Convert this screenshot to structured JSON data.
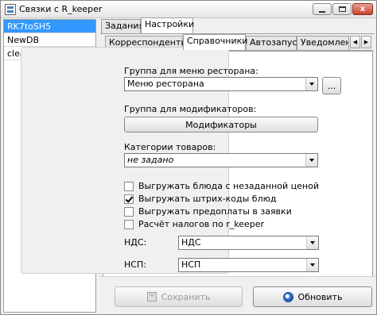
{
  "window": {
    "title": "Связки с R_keeper",
    "minimize_label": "",
    "maximize_label": "",
    "close_label": "x"
  },
  "list": {
    "items": [
      {
        "label": "RK7toSH5",
        "selected": true
      },
      {
        "label": "NewDB",
        "selected": false
      },
      {
        "label": "clear",
        "selected": false
      }
    ]
  },
  "outer_tabs": [
    {
      "label": "Задания",
      "active": false
    },
    {
      "label": "Настройки",
      "active": true
    }
  ],
  "inner_tabs": [
    {
      "label": "Корреспонденты",
      "active": false
    },
    {
      "label": "Справочники",
      "active": true
    },
    {
      "label": "Автозапуск",
      "active": false
    },
    {
      "label": "Уведомлени",
      "active": false
    }
  ],
  "form": {
    "menu_group_label": "Группа для меню ресторана:",
    "menu_group_value": "Меню ресторана",
    "browse_label": "...",
    "modifier_group_label": "Группа для модификаторов:",
    "modifier_button_label": "Модификаторы",
    "categories_label": "Категории товаров:",
    "categories_value": "не задано",
    "checkboxes": [
      {
        "label": "Выгружать блюда с незаданной ценой",
        "checked": false
      },
      {
        "label": "Выгружать штрих-коды блюд",
        "checked": true
      },
      {
        "label": "Выгружать предоплаты в заявки",
        "checked": false
      },
      {
        "label": "Расчёт налогов по r_keeper",
        "checked": false
      }
    ],
    "nds_label": "НДС:",
    "nds_value": "НДС",
    "nsp_label": "НСП:",
    "nsp_value": "НСП"
  },
  "actions": {
    "save_label": "Сохранить",
    "refresh_label": "Обновить"
  },
  "colors": {
    "selection": "#3399ff",
    "window_bg": "#f0f0f0"
  }
}
